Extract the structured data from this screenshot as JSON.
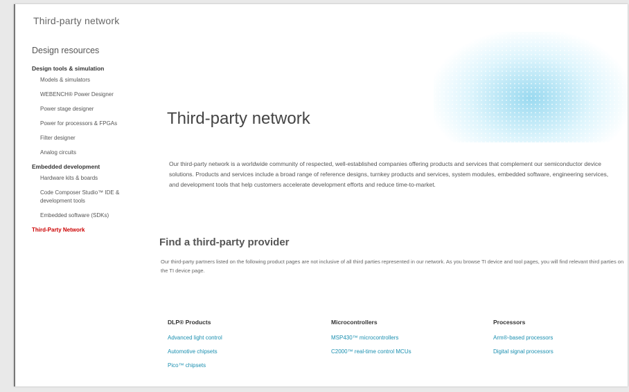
{
  "header": {
    "title": "Third-party network"
  },
  "sidebar": {
    "heading": "Design resources",
    "groups": [
      {
        "label": "Design tools & simulation",
        "items": [
          "Models & simulators",
          "WEBENCH® Power Designer",
          "Power stage designer",
          "Power for processors & FPGAs",
          "Filter designer",
          "Analog circuits"
        ]
      },
      {
        "label": "Embedded development",
        "items": [
          "Hardware kits & boards",
          "Code Composer Studio™ IDE & development tools",
          "Embedded software (SDKs)"
        ]
      }
    ],
    "active_item": "Third-Party Network"
  },
  "main": {
    "title": "Third-party network",
    "intro": "Our third-party network is a worldwide community of respected, well-established companies offering products and services that complement our semiconductor device solutions. Products and services include a broad range of reference designs, turnkey products and services, system modules, embedded software, engineering services, and development tools that help customers accelerate development efforts and reduce time-to-market.",
    "find_title": "Find a third-party provider",
    "find_desc": "Our third-party partners listed on the following product pages are not inclusive of all third parties represented in our network. As you browse TI device and tool pages, you will find relevant third parties on the TI device page.",
    "columns": [
      {
        "heading": "DLP® Products",
        "links": [
          "Advanced light control",
          "Automotive chipsets",
          "Pico™ chipsets"
        ]
      },
      {
        "heading": "Microcontrollers",
        "links": [
          "MSP430™ microcontrollers",
          "C2000™ real-time control MCUs"
        ]
      },
      {
        "heading": "Processors",
        "links": [
          "Arm®-based processors",
          "Digital signal processors"
        ]
      }
    ]
  },
  "colors": {
    "accent": "#cc0000",
    "link": "#1a8fb0"
  }
}
